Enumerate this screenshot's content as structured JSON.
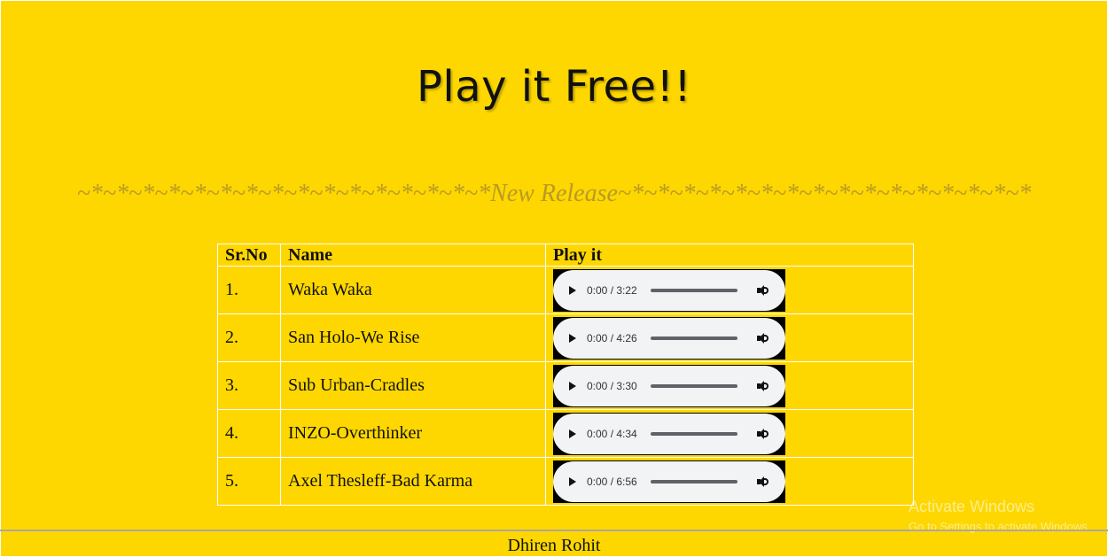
{
  "page": {
    "title": "Play it Free!!",
    "subtitle": "~*~*~*~*~*~*~*~*~*~*~*~*~*~*~*~*New Release~*~*~*~*~*~*~*~*~*~*~*~*~*~*~*~*"
  },
  "table": {
    "headers": {
      "no": "Sr.No",
      "name": "Name",
      "play": "Play it"
    },
    "rows": [
      {
        "no": "1.",
        "name": "Waka Waka",
        "time": "0:00 / 3:22"
      },
      {
        "no": "2.",
        "name": "San Holo-We Rise",
        "time": "0:00 / 4:26"
      },
      {
        "no": "3.",
        "name": "Sub Urban-Cradles",
        "time": "0:00 / 3:30"
      },
      {
        "no": "4.",
        "name": "INZO-Overthinker",
        "time": "0:00 / 4:34"
      },
      {
        "no": "5.",
        "name": "Axel Thesleff-Bad Karma",
        "time": "0:00 / 6:56"
      }
    ]
  },
  "footer": {
    "author": "Dhiren Rohit"
  },
  "watermark": {
    "title": "Activate Windows",
    "subtitle": "Go to Settings to activate Windows."
  },
  "colors": {
    "background": "#fed700",
    "subtitle": "#b89a26",
    "player_bg": "#f1f3f4"
  },
  "icons": {
    "play": "play-icon",
    "volume": "volume-icon"
  }
}
